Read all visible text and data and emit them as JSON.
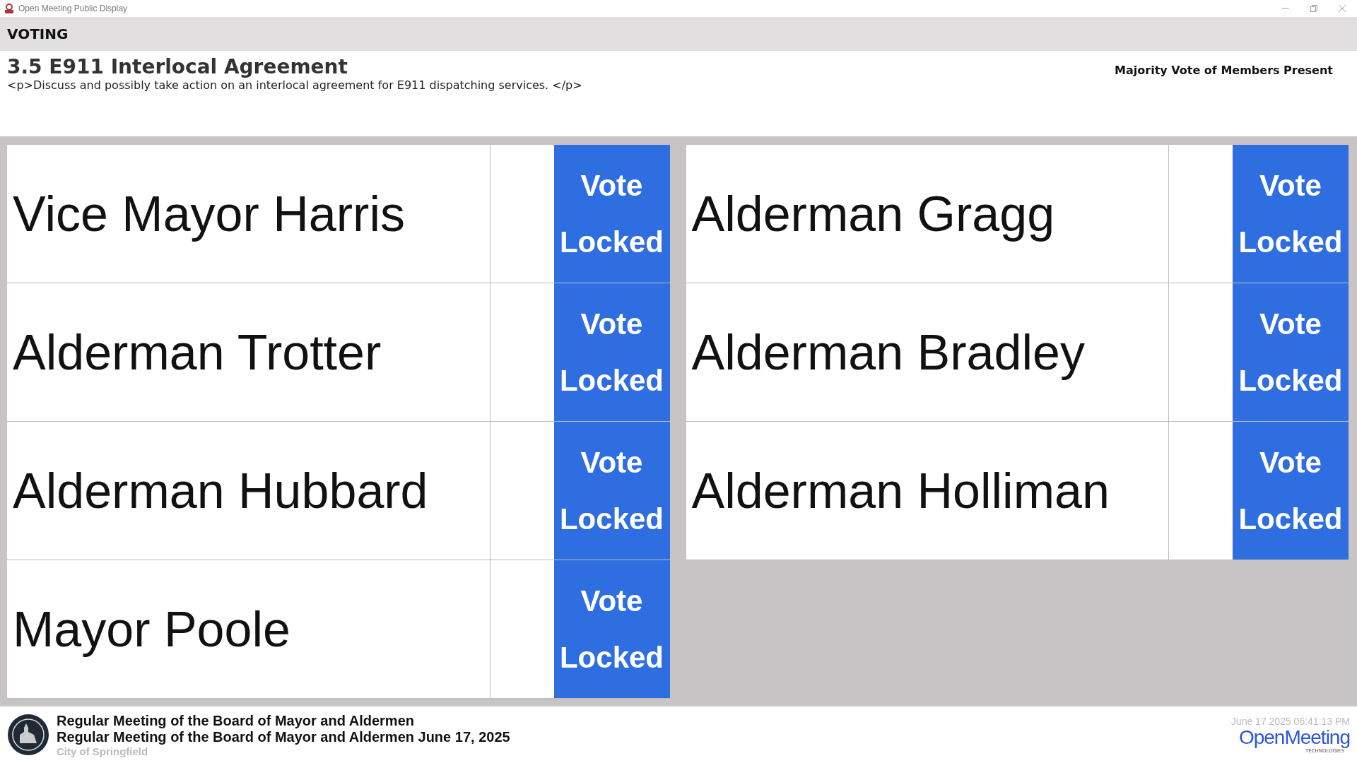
{
  "window": {
    "title": "Open Meeting Public Display"
  },
  "header": {
    "label": "VOTING"
  },
  "item": {
    "title": "3.5 E911 Interlocal Agreement",
    "description": "<p>Discuss and possibly take action on an interlocal agreement for E911 dispatching services. </p>",
    "vote_type": "Majority Vote of Members Present"
  },
  "members": [
    {
      "name": "Vice Mayor Harris",
      "status": "Vote Locked"
    },
    {
      "name": "Alderman Gragg",
      "status": "Vote Locked"
    },
    {
      "name": "Alderman Trotter",
      "status": "Vote Locked"
    },
    {
      "name": "Alderman Bradley",
      "status": "Vote Locked"
    },
    {
      "name": "Alderman Hubbard",
      "status": "Vote Locked"
    },
    {
      "name": "Alderman Holliman",
      "status": "Vote Locked"
    },
    {
      "name": "Mayor Poole",
      "status": "Vote Locked"
    }
  ],
  "footer": {
    "meeting": "Regular Meeting of the Board of Mayor and Aldermen",
    "meeting_date": "Regular Meeting of the Board of Mayor and Aldermen June 17, 2025",
    "organization": "City of Springfield",
    "timestamp": "June 17 2025 06:41:13 PM",
    "brand": "OpenMeeting",
    "brand_sub": "TECHNOLOGIES"
  }
}
